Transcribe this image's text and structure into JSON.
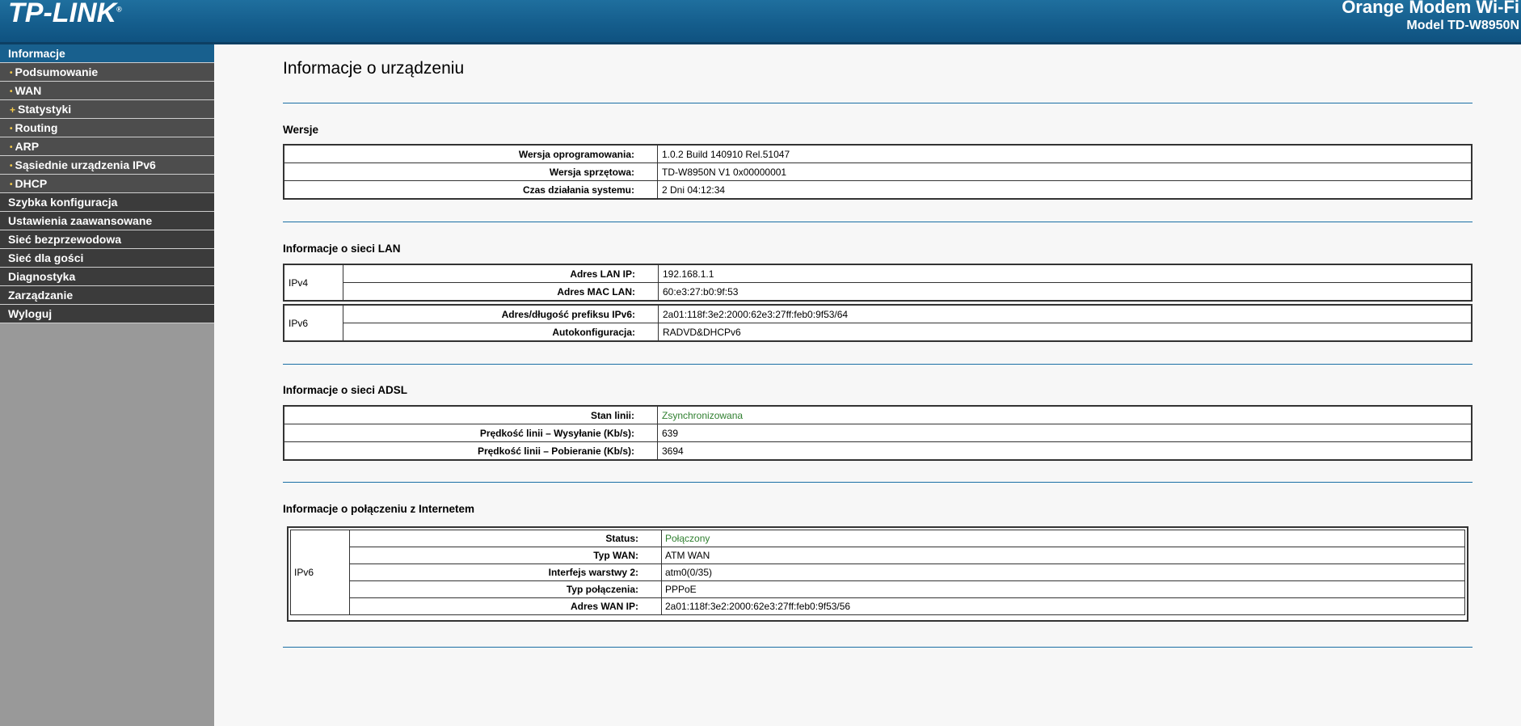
{
  "header": {
    "logo": "TP-LINK",
    "logo_mark": "®",
    "product_name": "Orange Modem Wi-Fi",
    "model": "Model TD-W8950N"
  },
  "sidebar": {
    "items": [
      {
        "label": "Informacje",
        "active": true,
        "level": 0
      },
      {
        "label": "Podsumowanie",
        "level": 1,
        "bullet": "•"
      },
      {
        "label": "WAN",
        "level": 1,
        "bullet": "•"
      },
      {
        "label": "Statystyki",
        "level": 1,
        "bullet": "+"
      },
      {
        "label": "Routing",
        "level": 1,
        "bullet": "•"
      },
      {
        "label": "ARP",
        "level": 1,
        "bullet": "•"
      },
      {
        "label": "Sąsiednie urządzenia IPv6",
        "level": 1,
        "bullet": "•"
      },
      {
        "label": "DHCP",
        "level": 1,
        "bullet": "•"
      },
      {
        "label": "Szybka konfiguracja",
        "level": 0
      },
      {
        "label": "Ustawienia zaawansowane",
        "level": 0
      },
      {
        "label": "Sieć bezprzewodowa",
        "level": 0
      },
      {
        "label": "Sieć dla gości",
        "level": 0
      },
      {
        "label": "Diagnostyka",
        "level": 0
      },
      {
        "label": "Zarządzanie",
        "level": 0
      },
      {
        "label": "Wyloguj",
        "level": 0
      }
    ]
  },
  "page": {
    "title": "Informacje o urządzeniu"
  },
  "versions": {
    "title": "Wersje",
    "rows": [
      {
        "label": "Wersja oprogramowania:",
        "value": "1.0.2 Build 140910 Rel.51047"
      },
      {
        "label": "Wersja sprzętowa:",
        "value": "TD-W8950N V1 0x00000001"
      },
      {
        "label": "Czas działania systemu:",
        "value": "2 Dni 04:12:34"
      }
    ]
  },
  "lan": {
    "title": "Informacje o sieci LAN",
    "ipv4": {
      "group": "IPv4",
      "rows": [
        {
          "label": "Adres LAN IP:",
          "value": "192.168.1.1"
        },
        {
          "label": "Adres MAC LAN:",
          "value": "60:e3:27:b0:9f:53"
        }
      ]
    },
    "ipv6": {
      "group": "IPv6",
      "rows": [
        {
          "label": "Adres/długość prefiksu IPv6:",
          "value": "2a01:118f:3e2:2000:62e3:27ff:feb0:9f53/64"
        },
        {
          "label": "Autokonfiguracja:",
          "value": "RADVD&DHCPv6"
        }
      ]
    }
  },
  "adsl": {
    "title": "Informacje o sieci ADSL",
    "rows": [
      {
        "label": "Stan linii:",
        "value": "Zsynchronizowana"
      },
      {
        "label": "Prędkość linii – Wysyłanie (Kb/s):",
        "value": "639"
      },
      {
        "label": "Prędkość linii – Pobieranie (Kb/s):",
        "value": "3694"
      }
    ]
  },
  "internet": {
    "title": "Informacje o połączeniu z Internetem",
    "group": "IPv6",
    "rows": [
      {
        "label": "Status:",
        "value": "Połączony"
      },
      {
        "label": "Typ WAN:",
        "value": "ATM WAN"
      },
      {
        "label": "Interfejs warstwy 2:",
        "value": "atm0(0/35)"
      },
      {
        "label": "Typ połączenia:",
        "value": "PPPoE"
      },
      {
        "label": "Adres WAN IP:",
        "value": "2a01:118f:3e2:2000:62e3:27ff:feb0:9f53/56"
      }
    ]
  },
  "colors": {
    "header_blue": "#155e8d",
    "active_menu": "#18608e",
    "status_green": "#2f7f2f",
    "divider_blue": "#1a6fa5"
  }
}
